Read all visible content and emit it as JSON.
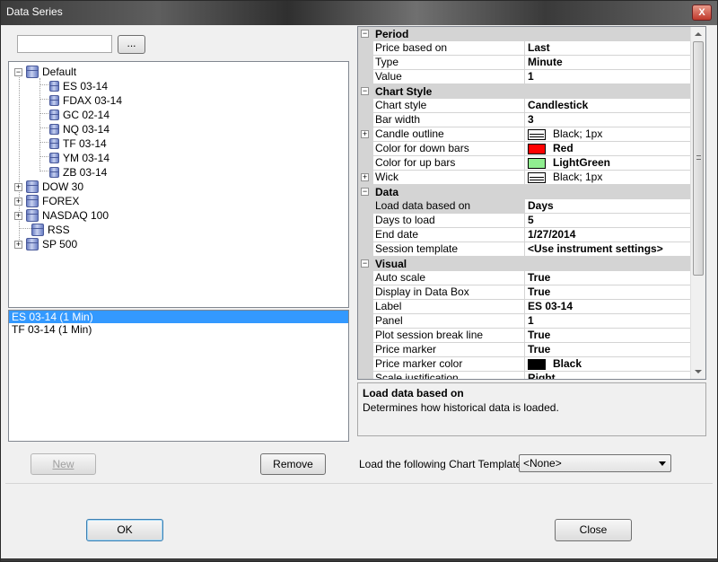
{
  "window": {
    "title": "Data Series",
    "close_glyph": "X"
  },
  "search": {
    "value": "",
    "browse_label": "..."
  },
  "tree": {
    "items": [
      {
        "label": "Default",
        "expanded": true,
        "glyph": "−"
      },
      {
        "label": "ES 03-14"
      },
      {
        "label": "FDAX 03-14"
      },
      {
        "label": "GC 02-14"
      },
      {
        "label": "NQ 03-14"
      },
      {
        "label": "TF 03-14"
      },
      {
        "label": "YM 03-14"
      },
      {
        "label": "ZB 03-14"
      },
      {
        "label": "DOW 30",
        "glyph": "+"
      },
      {
        "label": "FOREX",
        "glyph": "+"
      },
      {
        "label": "NASDAQ 100",
        "glyph": "+"
      },
      {
        "label": "RSS"
      },
      {
        "label": "SP 500",
        "glyph": "+"
      }
    ]
  },
  "series_list": {
    "items": [
      "ES 03-14 (1 Min)",
      "TF 03-14 (1 Min)"
    ],
    "selected": 0
  },
  "buttons": {
    "new": "New",
    "remove": "Remove",
    "ok": "OK",
    "close": "Close"
  },
  "properties": {
    "period": {
      "title": "Period",
      "glyph": "−",
      "rows": [
        {
          "name": "Price based on",
          "value": "Last"
        },
        {
          "name": "Type",
          "value": "Minute"
        },
        {
          "name": "Value",
          "value": "1"
        }
      ]
    },
    "chart_style": {
      "title": "Chart Style",
      "glyph": "−",
      "rows": [
        {
          "name": "Chart style",
          "value": "Candlestick"
        },
        {
          "name": "Bar width",
          "value": "3"
        },
        {
          "name": "Candle outline",
          "value": "Black; 1px",
          "expand": "+"
        },
        {
          "name": "Color for down bars",
          "value": "Red",
          "color": "#ff0000"
        },
        {
          "name": "Color for up bars",
          "value": "LightGreen",
          "color": "#90ee90"
        },
        {
          "name": "Wick",
          "value": "Black; 1px",
          "expand": "+"
        }
      ]
    },
    "data": {
      "title": "Data",
      "glyph": "−",
      "rows": [
        {
          "name": "Load data based on",
          "value": "Days"
        },
        {
          "name": "Days to load",
          "value": "5"
        },
        {
          "name": "End date",
          "value": "1/27/2014"
        },
        {
          "name": "Session template",
          "value": "<Use instrument settings>"
        }
      ]
    },
    "visual": {
      "title": "Visual",
      "glyph": "−",
      "rows": [
        {
          "name": "Auto scale",
          "value": "True"
        },
        {
          "name": "Display in Data Box",
          "value": "True"
        },
        {
          "name": "Label",
          "value": "ES 03-14"
        },
        {
          "name": "Panel",
          "value": "1"
        },
        {
          "name": "Plot session break line",
          "value": "True"
        },
        {
          "name": "Price marker",
          "value": "True"
        },
        {
          "name": "Price marker color",
          "value": "Black",
          "color": "#000000"
        },
        {
          "name": "Scale justification",
          "value": "Right"
        }
      ]
    }
  },
  "description": {
    "title": "Load data based on",
    "text": "Determines how historical data is loaded."
  },
  "template": {
    "label": "Load the following Chart Template:",
    "value": "<None>"
  }
}
